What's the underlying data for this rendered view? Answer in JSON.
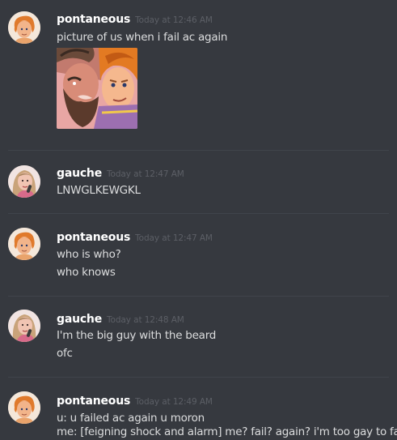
{
  "messages": [
    {
      "author": "pontaneous",
      "timestamp": "Today at 12:46 AM",
      "lines": [
        "picture of us when i fail ac again"
      ],
      "avatar_icon": "hercules-avatar-icon",
      "attachment_icon": "hercules-phil-image"
    },
    {
      "author": "gauche",
      "timestamp": "Today at 12:47 AM",
      "lines": [
        "LNWGLKEWGKL"
      ],
      "avatar_icon": "girl-avatar-icon"
    },
    {
      "author": "pontaneous",
      "timestamp": "Today at 12:47 AM",
      "lines": [
        "who is who?",
        "who knows"
      ],
      "avatar_icon": "hercules-avatar-icon"
    },
    {
      "author": "gauche",
      "timestamp": "Today at 12:48 AM",
      "lines": [
        "I'm the big guy with the beard",
        "ofc"
      ],
      "avatar_icon": "girl-avatar-icon"
    },
    {
      "author": "pontaneous",
      "timestamp": "Today at 12:49 AM",
      "lines": [
        "u: u failed ac again u moron",
        "me: [feigning shock and alarm] me? fail? again? i'm too gay to fail"
      ],
      "avatar_icon": "hercules-avatar-icon"
    }
  ],
  "colors": {
    "background": "#36393f",
    "username": "#ffffff",
    "timestamp": "#5c5f66",
    "message_text": "#dcddde",
    "divider": "#40444b"
  }
}
